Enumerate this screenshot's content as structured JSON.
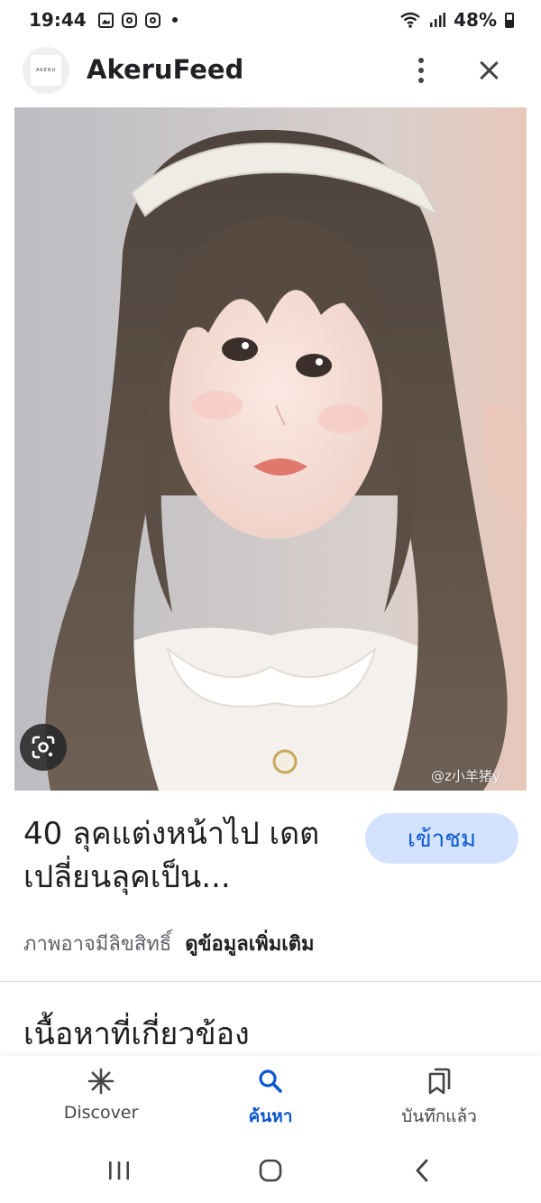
{
  "status_bar": {
    "time": "19:44",
    "battery": "48%",
    "icons": [
      "gallery-icon",
      "instagram-icon",
      "instagram-icon",
      "dot-icon",
      "wifi-icon",
      "signal-icon",
      "battery-icon"
    ]
  },
  "header": {
    "logo_text": "AKERU",
    "title": "AkeruFeed",
    "menu_icon": "more-vert-icon",
    "close_icon": "close-icon"
  },
  "image": {
    "watermark": "@z小羊猪y",
    "lens_icon": "google-lens-icon"
  },
  "result": {
    "title": "40 ลุคแต่งหน้าไป เดต เปลี่ยนลุคเป็น...",
    "visit_label": "เข้าชม",
    "copyright_text": "ภาพอาจมีลิขสิทธิ์",
    "more_info_label": "ดูข้อมูลเพิ่มเติม"
  },
  "related": {
    "heading": "เนื้อหาที่เกี่ยวข้อง"
  },
  "bottom_nav": {
    "items": [
      {
        "label": "Discover",
        "icon": "asterisk-icon",
        "active": false
      },
      {
        "label": "ค้นหา",
        "icon": "search-icon",
        "active": true
      },
      {
        "label": "บันทึกแล้ว",
        "icon": "saved-icon",
        "active": false
      }
    ]
  },
  "colors": {
    "accent": "#0b57d0",
    "visit_button_bg": "#d3e3fd",
    "text_primary": "#1f1f1f",
    "text_secondary": "#5f6368"
  }
}
